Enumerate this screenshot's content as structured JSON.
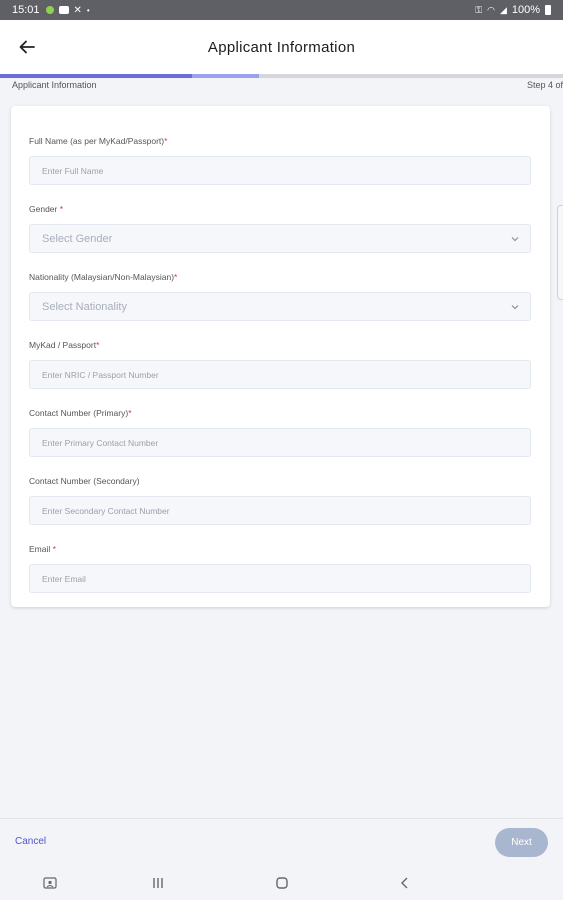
{
  "status_bar": {
    "time": "15:01",
    "battery": "100%"
  },
  "header": {
    "title": "Applicant Information"
  },
  "progress": {
    "fraction": 0.46,
    "step_label": "Applicant Information",
    "step_indicator": "Step 4 of"
  },
  "form": {
    "fields": [
      {
        "label": "Full Name (as per MyKad/Passport)",
        "required": "*",
        "placeholder": "Enter Full Name",
        "type": "text"
      },
      {
        "label": "Gender",
        "required": " *",
        "placeholder": "Select Gender",
        "type": "select"
      },
      {
        "label": "Nationality (Malaysian/Non-Malaysian)",
        "required": "*",
        "placeholder": "Select Nationality",
        "type": "select"
      },
      {
        "label": "MyKad / Passport",
        "required": "*",
        "placeholder": "Enter NRIC / Passport Number",
        "type": "text"
      },
      {
        "label": "Contact Number (Primary)",
        "required": "*",
        "placeholder": "Enter Primary Contact Number",
        "type": "text"
      },
      {
        "label": "Contact Number (Secondary)",
        "required": "",
        "placeholder": "Enter Secondary Contact Number",
        "type": "text"
      },
      {
        "label": "Email",
        "required": " *",
        "placeholder": "Enter Email",
        "type": "text"
      }
    ]
  },
  "footer": {
    "cancel_label": "Cancel",
    "next_label": "Next"
  },
  "colors": {
    "accent": "#5157c8",
    "progress": "#6b6ed6",
    "required": "#e0312b",
    "next_disabled": "#a9b6cf"
  }
}
